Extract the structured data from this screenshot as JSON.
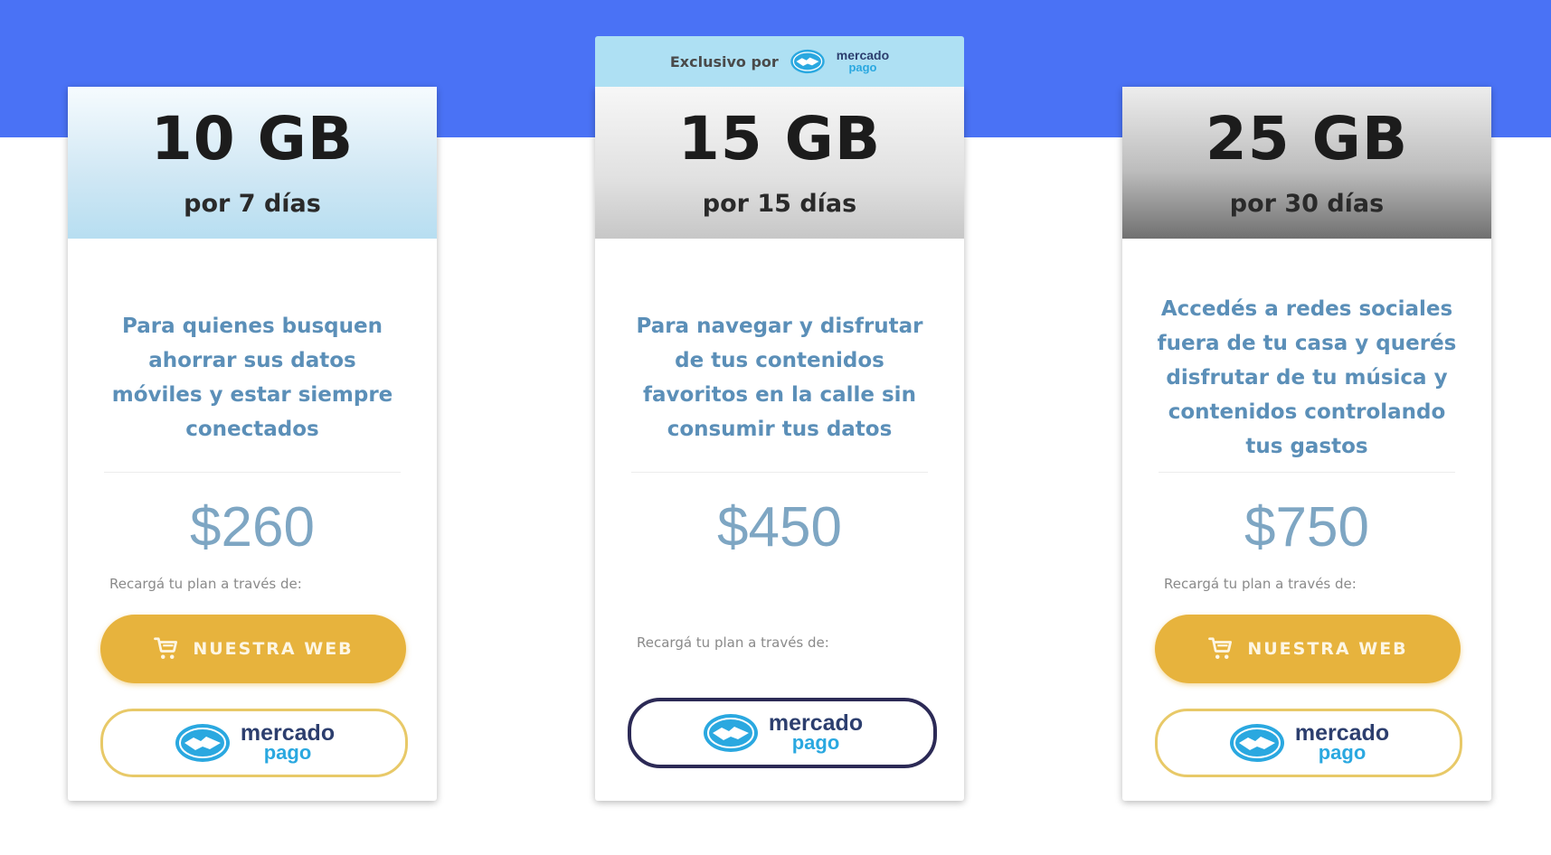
{
  "plans": [
    {
      "gb": "10 GB",
      "days": "por 7 días",
      "description": "Para quienes busquen ahorrar sus datos móviles y estar siempre conectados",
      "price": "$260",
      "recarga": "Recargá tu plan a través de:",
      "web_button": "NUESTRA WEB",
      "mp_line1": "mercado",
      "mp_line2": "pago"
    },
    {
      "exclusive_label": "Exclusivo por",
      "exclusive_mp_line1": "mercado",
      "exclusive_mp_line2": "pago",
      "gb": "15 GB",
      "days": "por 15 días",
      "description": "Para navegar y disfrutar de tus contenidos favoritos en la calle sin consumir tus datos",
      "price": "$450",
      "recarga": "Recargá tu plan a través de:",
      "mp_line1": "mercado",
      "mp_line2": "pago"
    },
    {
      "gb": "25 GB",
      "days": "por 30 días",
      "description": "Accedés a redes sociales fuera de tu casa y querés disfrutar de tu música y contenidos controlando tus gastos",
      "price": "$750",
      "recarga": "Recargá tu plan a través de:",
      "web_button": "NUESTRA WEB",
      "mp_line1": "mercado",
      "mp_line2": "pago"
    }
  ],
  "colors": {
    "top_band": "#4a72f5",
    "button_gold": "#e7b33d",
    "description_blue": "#5b8fb8",
    "price_blue": "#7ea6c3"
  },
  "icons": [
    "cart-icon",
    "mercado-pago-handshake-icon"
  ]
}
